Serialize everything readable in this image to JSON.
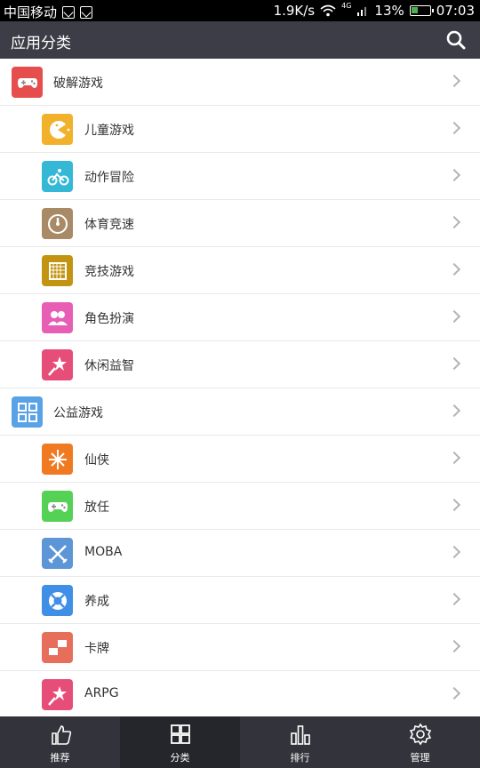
{
  "status_bar": {
    "carrier": "中国移动",
    "speed": "1.9K/s",
    "network": "4G",
    "battery": "13%",
    "time": "07:03"
  },
  "header": {
    "title": "应用分类"
  },
  "categories": [
    {
      "label": "破解游戏",
      "icon": "gamepad-icon",
      "color": "#e64d4d",
      "level": "parent"
    },
    {
      "label": "儿童游戏",
      "icon": "pacman-icon",
      "color": "#f1b12b",
      "level": "child"
    },
    {
      "label": "动作冒险",
      "icon": "bicycle-icon",
      "color": "#35b7d6",
      "level": "child"
    },
    {
      "label": "体育竞速",
      "icon": "speedometer-icon",
      "color": "#a88a66",
      "level": "child"
    },
    {
      "label": "竞技游戏",
      "icon": "grid-board-icon",
      "color": "#c39411",
      "level": "child"
    },
    {
      "label": "角色扮演",
      "icon": "people-icon",
      "color": "#e85eb5",
      "level": "child"
    },
    {
      "label": "休闲益智",
      "icon": "magic-wand-icon",
      "color": "#e64d79",
      "level": "child"
    },
    {
      "label": "公益游戏",
      "icon": "apps-grid-icon",
      "color": "#5aa2e6",
      "level": "parent"
    },
    {
      "label": "仙侠",
      "icon": "snowflake-icon",
      "color": "#f07a22",
      "level": "child"
    },
    {
      "label": "放任",
      "icon": "gamepad-icon",
      "color": "#55d155",
      "level": "child"
    },
    {
      "label": "MOBA",
      "icon": "crossed-swords-icon",
      "color": "#5d96d6",
      "level": "child"
    },
    {
      "label": "养成",
      "icon": "lifebuoy-icon",
      "color": "#3f8fe6",
      "level": "child"
    },
    {
      "label": "卡牌",
      "icon": "cards-icon",
      "color": "#e86e5c",
      "level": "child"
    },
    {
      "label": "ARPG",
      "icon": "magic-wand-icon",
      "color": "#e64d79",
      "level": "child"
    }
  ],
  "bottom_nav": [
    {
      "label": "推荐",
      "icon": "thumbs-up-icon",
      "active": false
    },
    {
      "label": "分类",
      "icon": "grid-icon",
      "active": true
    },
    {
      "label": "排行",
      "icon": "bar-chart-icon",
      "active": false
    },
    {
      "label": "管理",
      "icon": "gear-icon",
      "active": false
    }
  ]
}
